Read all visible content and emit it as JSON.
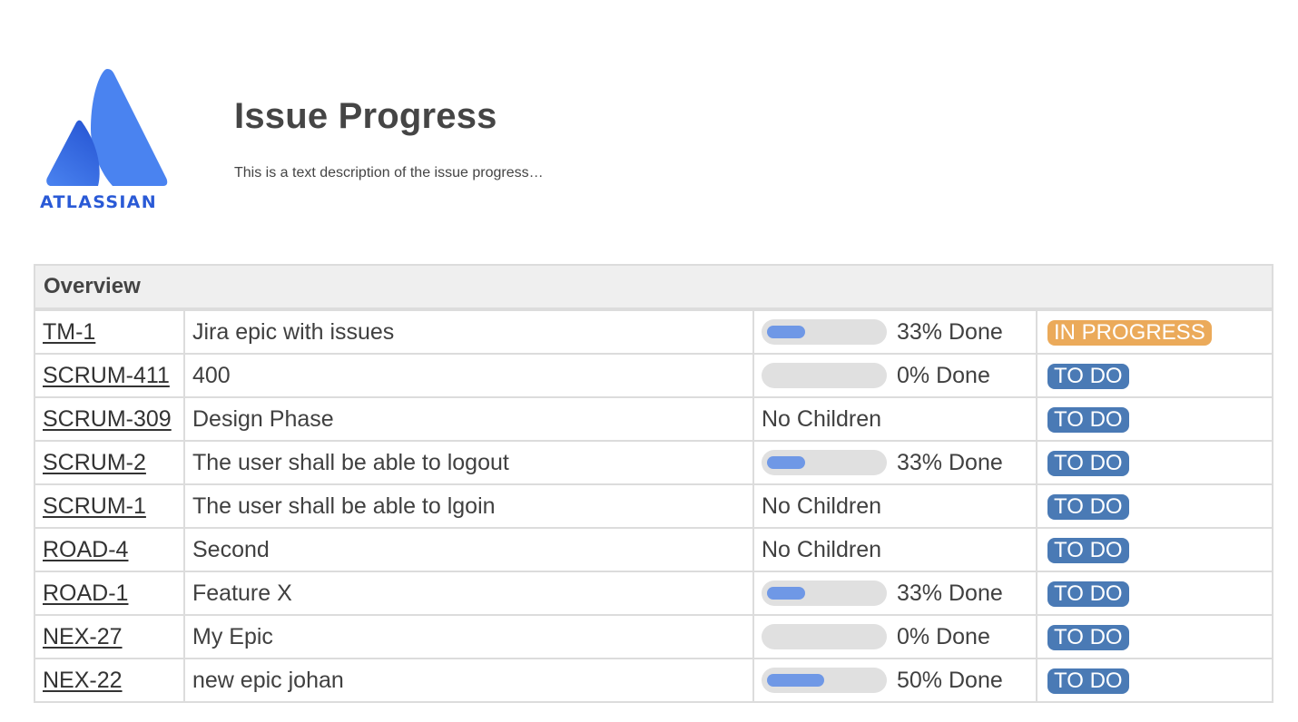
{
  "logo": {
    "wordmark": "ATLASSIAN",
    "color": "#2a5ad6"
  },
  "header": {
    "title": "Issue Progress",
    "description": "This is a text description of the issue progress…"
  },
  "table": {
    "header": "Overview",
    "status_colors": {
      "IN PROGRESS": "#ebaa5a",
      "TO DO": "#4a7ab5"
    },
    "rows": [
      {
        "key": "TM-1",
        "summary": "Jira epic with issues",
        "progress": 33,
        "progress_label": "33% Done",
        "status": "IN PROGRESS"
      },
      {
        "key": "SCRUM-411",
        "summary": "400",
        "progress": 0,
        "progress_label": "0% Done",
        "status": "TO DO"
      },
      {
        "key": "SCRUM-309",
        "summary": "Design Phase",
        "progress": null,
        "progress_label": "No Children",
        "status": "TO DO"
      },
      {
        "key": "SCRUM-2",
        "summary": "The user shall be able to logout",
        "progress": 33,
        "progress_label": "33% Done",
        "status": "TO DO"
      },
      {
        "key": "SCRUM-1",
        "summary": "The user shall be able to lgoin",
        "progress": null,
        "progress_label": "No Children",
        "status": "TO DO"
      },
      {
        "key": "ROAD-4",
        "summary": "Second",
        "progress": null,
        "progress_label": "No Children",
        "status": "TO DO"
      },
      {
        "key": "ROAD-1",
        "summary": "Feature X",
        "progress": 33,
        "progress_label": "33% Done",
        "status": "TO DO"
      },
      {
        "key": "NEX-27",
        "summary": "My Epic",
        "progress": 0,
        "progress_label": "0% Done",
        "status": "TO DO"
      },
      {
        "key": "NEX-22",
        "summary": "new epic johan",
        "progress": 50,
        "progress_label": "50% Done",
        "status": "TO DO"
      }
    ]
  }
}
